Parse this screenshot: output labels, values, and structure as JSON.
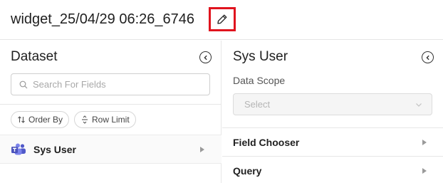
{
  "header": {
    "title": "widget_25/04/29 06:26_6746"
  },
  "dataset_panel": {
    "title": "Dataset",
    "search": {
      "placeholder": "Search For Fields",
      "value": ""
    },
    "order_by_label": "Order By",
    "row_limit_label": "Row Limit",
    "items": [
      {
        "label": "Sys User",
        "icon": "teams-icon"
      }
    ]
  },
  "config_panel": {
    "title": "Sys User",
    "data_scope": {
      "label": "Data Scope",
      "placeholder": "Select"
    },
    "sections": [
      {
        "label": "Field Chooser"
      },
      {
        "label": "Query"
      }
    ]
  },
  "colors": {
    "highlight_border": "#e0141e",
    "teams_brand": "#5059c9"
  }
}
